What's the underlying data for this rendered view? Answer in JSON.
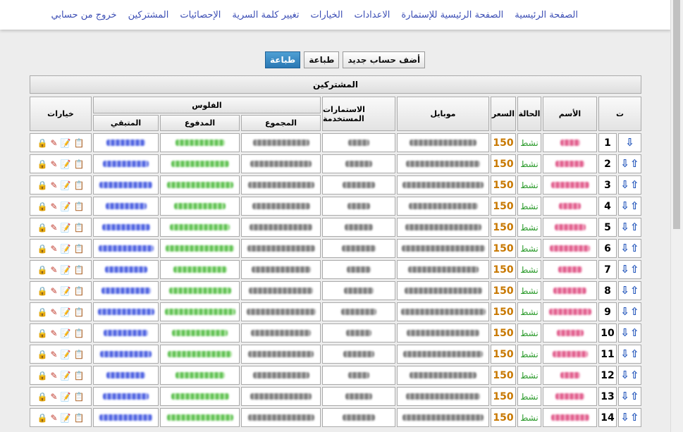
{
  "nav": {
    "items": [
      "الصفحة الرئيسية",
      "الصفحة الرئيسية للإستمارة",
      "الاعدادات",
      "الخيارات",
      "تغيير كلمة السرية",
      "الإحصائيات",
      "المشتركين",
      "خروج من حسابي"
    ]
  },
  "toolbar": {
    "add_label": "أضف حساب جديد",
    "print_label": "طباعة",
    "print2_label": "طباعة"
  },
  "panel": {
    "title": "المشتركين"
  },
  "table": {
    "headers": {
      "index": "ت",
      "name": "الأسم",
      "status": "الحالة",
      "price": "السعر",
      "mobile": "موبايل",
      "forms": "الاستمارات المستخدمة",
      "money": "الفلوس",
      "total": "المجموع",
      "paid": "المدفوع",
      "remaining": "المتبقي",
      "options": "خيارات"
    },
    "rows": [
      {
        "n": "1",
        "status": "نشط",
        "price": "150"
      },
      {
        "n": "2",
        "status": "نشط",
        "price": "150"
      },
      {
        "n": "3",
        "status": "نشط",
        "price": "150"
      },
      {
        "n": "4",
        "status": "نشط",
        "price": "150"
      },
      {
        "n": "5",
        "status": "نشط",
        "price": "150"
      },
      {
        "n": "6",
        "status": "نشط",
        "price": "150"
      },
      {
        "n": "7",
        "status": "نشط",
        "price": "150"
      },
      {
        "n": "8",
        "status": "نشط",
        "price": "150"
      },
      {
        "n": "9",
        "status": "نشط",
        "price": "150"
      },
      {
        "n": "10",
        "status": "نشط",
        "price": "150"
      },
      {
        "n": "11",
        "status": "نشط",
        "price": "150"
      },
      {
        "n": "12",
        "status": "نشط",
        "price": "150"
      },
      {
        "n": "13",
        "status": "نشط",
        "price": "150"
      },
      {
        "n": "14",
        "status": "نشط",
        "price": "150"
      }
    ]
  },
  "icons": {
    "move_down": "arrow-down-icon",
    "move_up": "arrow-up-icon",
    "lock": "lock-icon",
    "edit": "pencil-icon",
    "note": "edit-note-icon",
    "details": "document-icon"
  }
}
